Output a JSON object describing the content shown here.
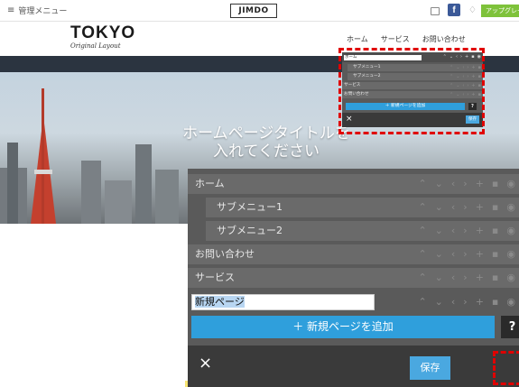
{
  "admin_bar": {
    "menu_label": "管理メニュー",
    "logo": "JIMDO",
    "upgrade_label": "アップグレー",
    "icons": [
      "menu-icon",
      "phone-icon",
      "facebook-icon",
      "bell-icon"
    ]
  },
  "site": {
    "brand_name": "TOKYO",
    "brand_tagline": "Original Layout",
    "nav": [
      "ホーム",
      "サービス",
      "お問い合わせ"
    ]
  },
  "hero": {
    "title_line1": "ホームページタイトルを",
    "title_line2": "入れてください"
  },
  "menu_editor_small": {
    "new_page_value": "ホーム",
    "items": [
      {
        "label": "サブメニュー1",
        "indent": 1
      },
      {
        "label": "サブメニュー2",
        "indent": 1
      },
      {
        "label": "サービス",
        "indent": 0
      },
      {
        "label": "お問い合わせ",
        "indent": 0
      }
    ],
    "add_page_label": "＋ 新規ページを追加",
    "help_label": "?",
    "close_label": "×",
    "save_label": "保存"
  },
  "menu_editor": {
    "items": [
      {
        "label": "ホーム",
        "indent": 0
      },
      {
        "label": "サブメニュー1",
        "indent": 1
      },
      {
        "label": "サブメニュー2",
        "indent": 1
      },
      {
        "label": "お問い合わせ",
        "indent": 0
      },
      {
        "label": "サービス",
        "indent": 0
      }
    ],
    "new_page_value": "新規ページ",
    "add_page_label": "＋ 新規ページを追加",
    "help_label": "?",
    "close_label": "×",
    "save_label": "保存"
  },
  "colors": {
    "highlight": "#e00000",
    "add_button": "#2f9fdc",
    "save_button": "#4aa8e0",
    "panel": "#5a5a5a",
    "upgrade": "#7ec23a"
  }
}
